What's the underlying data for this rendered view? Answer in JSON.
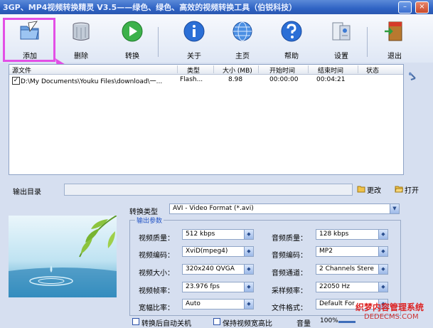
{
  "window": {
    "title": "3GP、MP4视频转换精灵 V3.5——绿色、绿色、高效的视频转换工具（伯锐科技）",
    "min_glyph": "–",
    "close_glyph": "×"
  },
  "toolbar": {
    "items": [
      {
        "label": "添加",
        "icon": "folder-add-icon"
      },
      {
        "label": "删除",
        "icon": "trash-icon"
      },
      {
        "label": "转换",
        "icon": "play-icon"
      },
      {
        "label": "关于",
        "icon": "info-icon"
      },
      {
        "label": "主页",
        "icon": "globe-icon"
      },
      {
        "label": "帮助",
        "icon": "help-icon"
      },
      {
        "label": "设置",
        "icon": "settings-icon"
      },
      {
        "label": "退出",
        "icon": "exit-door-icon"
      }
    ],
    "highlight_color": "#e34fe6"
  },
  "file_list": {
    "columns": [
      "源文件",
      "类型",
      "大小 (MB)",
      "开始时间",
      "结束时间",
      "状态"
    ],
    "rows": [
      {
        "checked": true,
        "source": "D:\\My Documents\\Youku Files\\download\\一...",
        "type": "Flash...",
        "size": "8.98",
        "start": "00:00:00",
        "end": "00:04:21",
        "status": ""
      }
    ]
  },
  "output": {
    "label": "输出目录",
    "value": "",
    "change_label": "更改",
    "open_label": "打开"
  },
  "conversion": {
    "type_label": "转换类型",
    "type_value": "AVI - Video Format (*.avi)",
    "group_title": "输出参数",
    "video_quality_label": "视频质量：",
    "video_quality": "512 kbps",
    "video_codec_label": "视频编码：",
    "video_codec": "XviD(mpeg4)",
    "video_size_label": "视频大小：",
    "video_size": "320x240 QVGA",
    "video_fps_label": "视频帧率：",
    "video_fps": "23.976 fps",
    "aspect_label": "宽幅比率：",
    "aspect": "Auto",
    "audio_quality_label": "音频质量：",
    "audio_quality": "128 kbps",
    "audio_codec_label": "音频编码：",
    "audio_codec": "MP2",
    "audio_channel_label": "音频通道：",
    "audio_channel": "2 Channels Stere",
    "sample_rate_label": "采样频率：",
    "sample_rate": "22050 Hz",
    "file_format_label": "文件格式：",
    "file_format": "Default For"
  },
  "bottom": {
    "auto_shutdown_label": "转换后自动关机",
    "keep_ratio_label": "保持视频宽高比",
    "volume_label": "音量",
    "volume_value": "100%",
    "volume_level": 1.0
  },
  "watermark": {
    "line1": "织梦内容管理系统",
    "line2": "DEDECMS.COM"
  }
}
